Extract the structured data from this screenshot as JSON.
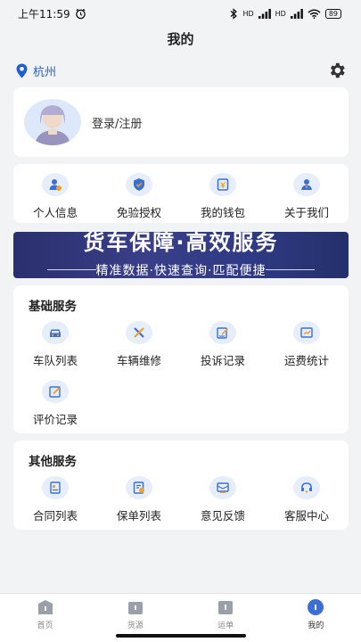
{
  "status_bar": {
    "time": "上午11:59",
    "network_label": "HD",
    "network_label_2": "HD",
    "battery": "89"
  },
  "header": {
    "title": "我的"
  },
  "location": {
    "city": "杭州"
  },
  "profile": {
    "login_label": "登录/注册"
  },
  "quick_links": [
    {
      "label": "个人信息",
      "icon": "person-badge-icon"
    },
    {
      "label": "免验授权",
      "icon": "shield-icon"
    },
    {
      "label": "我的钱包",
      "icon": "wallet-icon"
    },
    {
      "label": "关于我们",
      "icon": "team-icon"
    }
  ],
  "banner": {
    "title": "货车保障·高效服务",
    "subtitle": "精准数据·快速查询·匹配便捷"
  },
  "basic_services": {
    "title": "基础服务",
    "items": [
      {
        "label": "车队列表",
        "icon": "car-icon"
      },
      {
        "label": "车辆维修",
        "icon": "wrench-icon"
      },
      {
        "label": "投诉记录",
        "icon": "edit-note-icon"
      },
      {
        "label": "运费统计",
        "icon": "chart-card-icon"
      },
      {
        "label": "评价记录",
        "icon": "pencil-icon"
      }
    ]
  },
  "other_services": {
    "title": "其他服务",
    "items": [
      {
        "label": "合同列表",
        "icon": "document-icon"
      },
      {
        "label": "保单列表",
        "icon": "policy-icon"
      },
      {
        "label": "意见反馈",
        "icon": "feedback-icon"
      },
      {
        "label": "客服中心",
        "icon": "headset-icon"
      }
    ]
  },
  "tabbar": {
    "tabs": [
      {
        "label": "首页",
        "active": false
      },
      {
        "label": "货源",
        "active": false
      },
      {
        "label": "运单",
        "active": false
      },
      {
        "label": "我的",
        "active": true
      }
    ]
  },
  "colors": {
    "accent": "#1c5fd6",
    "background": "#f2f3f5",
    "icon_bg": "#e6eefc",
    "tab_active": "#3b6fd8",
    "tab_inactive": "#9aa0aa"
  }
}
